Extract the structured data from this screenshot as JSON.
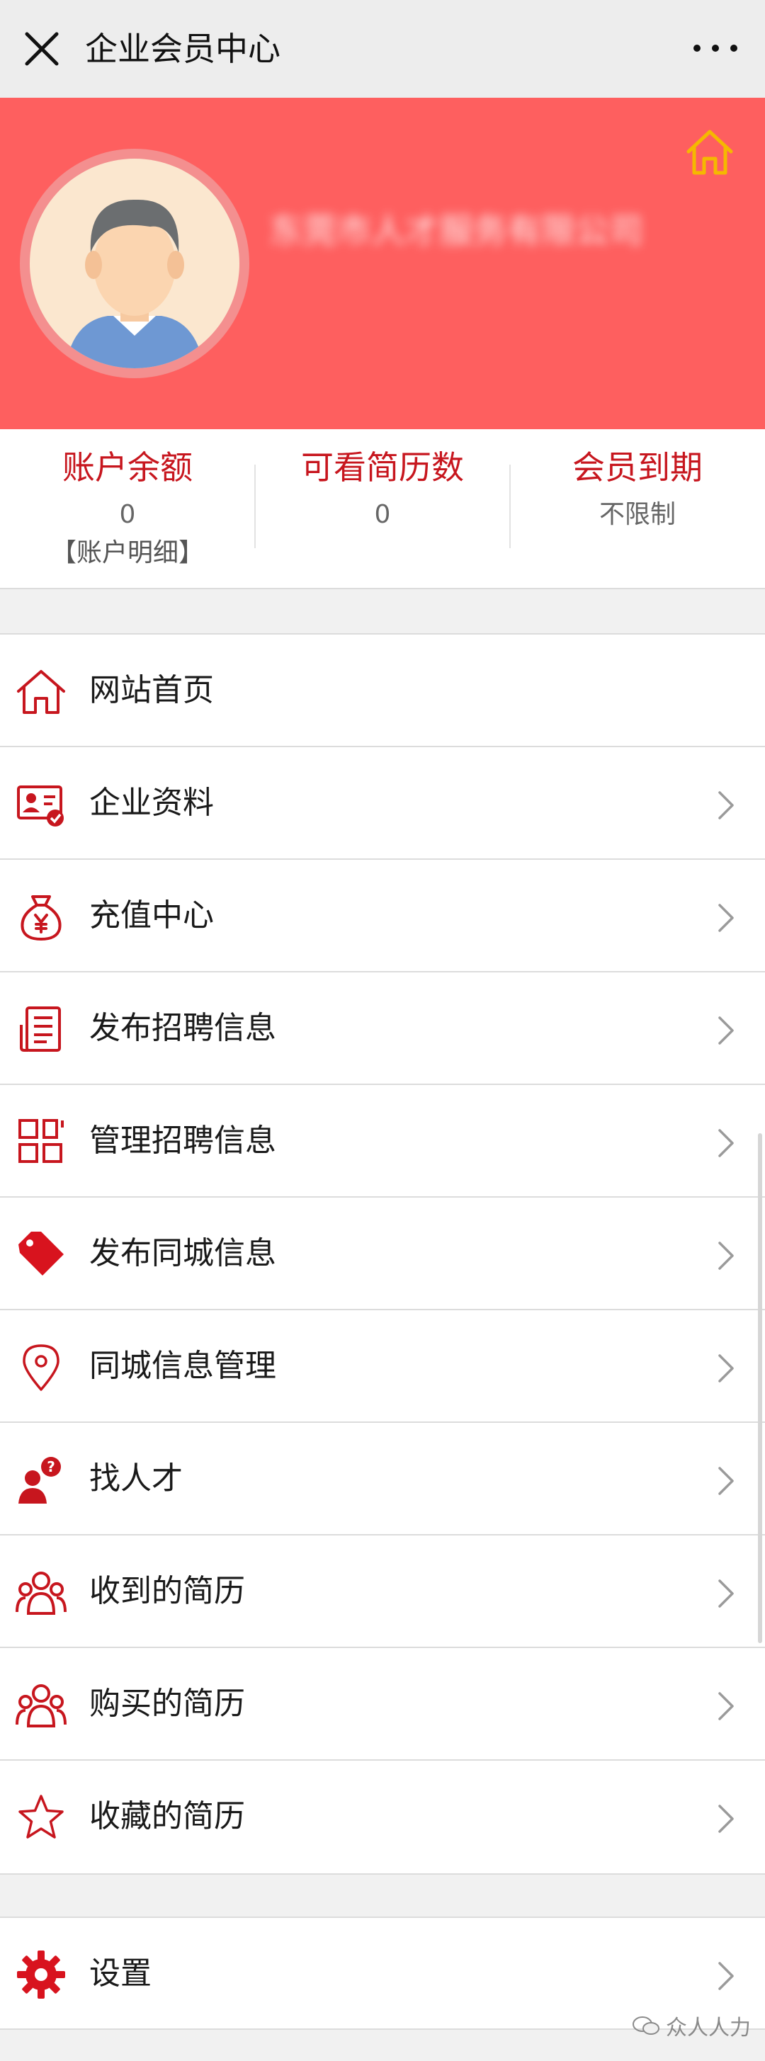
{
  "topbar": {
    "title": "企业会员中心"
  },
  "profile": {
    "name": "东莞市人才服务有限公司"
  },
  "stats": [
    {
      "label": "账户余额",
      "value": "0",
      "link": "【账户明细】"
    },
    {
      "label": "可看简历数",
      "value": "0"
    },
    {
      "label": "会员到期",
      "value": "不限制"
    }
  ],
  "menu": [
    {
      "label": "网站首页",
      "icon": "home-outline-icon"
    },
    {
      "label": "企业资料",
      "icon": "id-card-icon"
    },
    {
      "label": "充值中心",
      "icon": "money-bag-icon"
    },
    {
      "label": "发布招聘信息",
      "icon": "document-icon"
    },
    {
      "label": "管理招聘信息",
      "icon": "grid-icon"
    },
    {
      "label": "发布同城信息",
      "icon": "tag-icon"
    },
    {
      "label": "同城信息管理",
      "icon": "location-pin-icon"
    },
    {
      "label": "找人才",
      "icon": "find-talent-icon"
    },
    {
      "label": "收到的简历",
      "icon": "group-icon"
    },
    {
      "label": "购买的简历",
      "icon": "group-icon"
    },
    {
      "label": "收藏的简历",
      "icon": "star-icon"
    }
  ],
  "settings": {
    "label": "设置",
    "icon": "gear-icon"
  },
  "watermark": {
    "text": "众人人力"
  },
  "colors": {
    "accent": "#c7161e",
    "header": "#fe5f5f",
    "home": "#f5b800"
  }
}
